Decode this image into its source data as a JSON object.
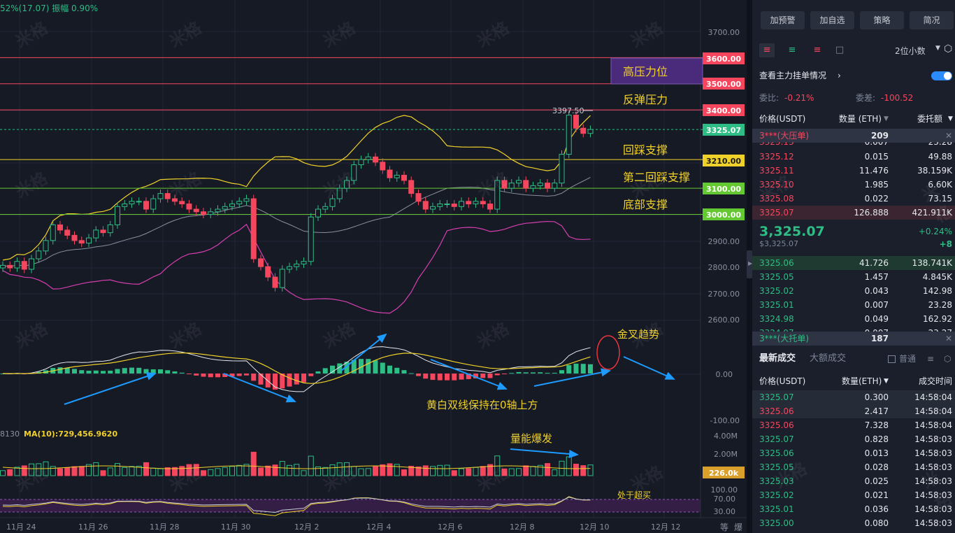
{
  "topleft_info": "52%(17.07) 振幅 0.90%",
  "watermark": "米格",
  "price_axis": {
    "ticks": [
      {
        "label": "3700.00",
        "value": 3700
      },
      {
        "label": "2900.00",
        "value": 2900
      },
      {
        "label": "2800.00",
        "value": 2800
      },
      {
        "label": "2700.00",
        "value": 2700
      },
      {
        "label": "2600.00",
        "value": 2600
      }
    ],
    "tags": [
      {
        "label": "3600.00",
        "value": 3600,
        "color": "#f6465d"
      },
      {
        "label": "3500.00",
        "value": 3500,
        "color": "#f6465d"
      },
      {
        "label": "3400.00",
        "value": 3400,
        "color": "#f6465d"
      },
      {
        "label": "3325.07",
        "value": 3325.07,
        "color": "#2ebd85"
      },
      {
        "label": "3210.00",
        "value": 3210,
        "color": "#f0d12a"
      },
      {
        "label": "3100.00",
        "value": 3100,
        "color": "#64c832"
      },
      {
        "label": "3000.00",
        "value": 3000,
        "color": "#64c832"
      }
    ],
    "high_marker": "3397.50"
  },
  "annotations": {
    "high_pressure": "高压力位",
    "rebound_pressure": "反弹压力",
    "pullback_support": "回踩支撑",
    "second_pullback": "第二回踩支撑",
    "bottom_support": "底部支撑",
    "golden_cross": "金叉趋势",
    "dual_lines": "黄白双线保持在0轴上方",
    "volume_burst": "量能爆发",
    "overbought": "处于超买"
  },
  "macd_axis": {
    "zero": "0.00",
    "neg": "-100.00"
  },
  "volume": {
    "info_prefix": "8130",
    "ma_label": "MA(10):729,456.9620",
    "ticks": [
      "4.00M",
      "2.00M"
    ],
    "tag": "226.0k"
  },
  "rsi_axis": {
    "ticks": [
      "100.00",
      "70.00",
      "30.00"
    ]
  },
  "dates": [
    "11月 24",
    "11月 26",
    "11月 28",
    "11月 30",
    "12月 2",
    "12月 4",
    "12月 6",
    "12月 8",
    "12月 10",
    "12月 12"
  ],
  "corner_labels": [
    "等",
    "爆"
  ],
  "chart_data": {
    "type": "candlestick",
    "title": "",
    "x_tick_labels": [
      "11月 24",
      "11月 26",
      "11月 28",
      "11月 30",
      "12月 2",
      "12月 4",
      "12月 6",
      "12月 8",
      "12月 10",
      "12月 12"
    ],
    "y_range": [
      2500,
      3750
    ],
    "horizontal_levels": [
      3600,
      3500,
      3400,
      3210,
      3100,
      3000
    ],
    "last_price": 3325.07,
    "period_high": 3397.5,
    "closes": [
      2805,
      2795,
      2820,
      2790,
      2830,
      2860,
      2900,
      2960,
      2940,
      2920,
      2900,
      2890,
      2910,
      2940,
      2930,
      2960,
      3030,
      3040,
      3050,
      3050,
      3020,
      3060,
      3080,
      3060,
      3050,
      3040,
      3020,
      3010,
      3000,
      3010,
      3020,
      3030,
      3040,
      3050,
      3060,
      2830,
      2800,
      2760,
      2720,
      2790,
      2800,
      2810,
      2820,
      2990,
      3020,
      3030,
      3060,
      3100,
      3130,
      3190,
      3210,
      3220,
      3200,
      3170,
      3140,
      3150,
      3130,
      3080,
      3050,
      3020,
      3030,
      3040,
      3040,
      3030,
      3050,
      3040,
      3050,
      3040,
      3020,
      3130,
      3100,
      3120,
      3130,
      3100,
      3110,
      3120,
      3100,
      3120,
      3230,
      3380,
      3330,
      3310,
      3325.07
    ]
  },
  "panel": {
    "top_buttons": [
      "加预警",
      "加自选",
      "策略",
      "简况"
    ],
    "decimals": "2位小数",
    "main_orders": "查看主力挂单情况",
    "wei_bi_label": "委比:",
    "wei_bi": "-0.21%",
    "wei_cha_label": "委差:",
    "wei_cha": "-100.52",
    "ob_headers": [
      "价格(USDT)",
      "数量 (ETH)",
      "委托额"
    ],
    "ask_big": {
      "label": "3***(大压单)",
      "qty": "209"
    },
    "asks": [
      [
        "3325.13",
        "0.007",
        "23.28"
      ],
      [
        "3325.12",
        "0.015",
        "49.88"
      ],
      [
        "3325.11",
        "11.476",
        "38.159K"
      ],
      [
        "3325.10",
        "1.985",
        "6.60K"
      ],
      [
        "3325.08",
        "0.022",
        "73.15"
      ],
      [
        "3325.07",
        "126.888",
        "421.911K"
      ]
    ],
    "mid_price": "3,325.07",
    "mid_usd": "$3,325.07",
    "mid_change": "+0.24%",
    "mid_delta": "+8",
    "bids": [
      [
        "3325.06",
        "41.726",
        "138.741K"
      ],
      [
        "3325.05",
        "1.457",
        "4.845K"
      ],
      [
        "3325.02",
        "0.043",
        "142.98"
      ],
      [
        "3325.01",
        "0.007",
        "23.28"
      ],
      [
        "3324.98",
        "0.049",
        "162.92"
      ],
      [
        "3324.97",
        "0.007",
        "23.27"
      ]
    ],
    "bid_big": {
      "label": "3***(大托单)",
      "qty": "187"
    },
    "trade_tabs": [
      "最新成交",
      "大额成交"
    ],
    "normal_label": "普通",
    "trade_headers": [
      "价格(USDT)",
      "数量(ETH)",
      "成交时间"
    ],
    "trades": [
      [
        "3325.07",
        "0.300",
        "14:58:04",
        "g"
      ],
      [
        "3325.06",
        "2.417",
        "14:58:04",
        "r"
      ],
      [
        "3325.06",
        "7.328",
        "14:58:04",
        "r"
      ],
      [
        "3325.07",
        "0.828",
        "14:58:03",
        "g"
      ],
      [
        "3325.06",
        "0.013",
        "14:58:03",
        "g"
      ],
      [
        "3325.05",
        "0.028",
        "14:58:03",
        "g"
      ],
      [
        "3325.03",
        "0.025",
        "14:58:03",
        "g"
      ],
      [
        "3325.02",
        "0.021",
        "14:58:03",
        "g"
      ],
      [
        "3325.01",
        "0.036",
        "14:58:03",
        "g"
      ],
      [
        "3325.00",
        "0.080",
        "14:58:03",
        "g"
      ]
    ]
  }
}
